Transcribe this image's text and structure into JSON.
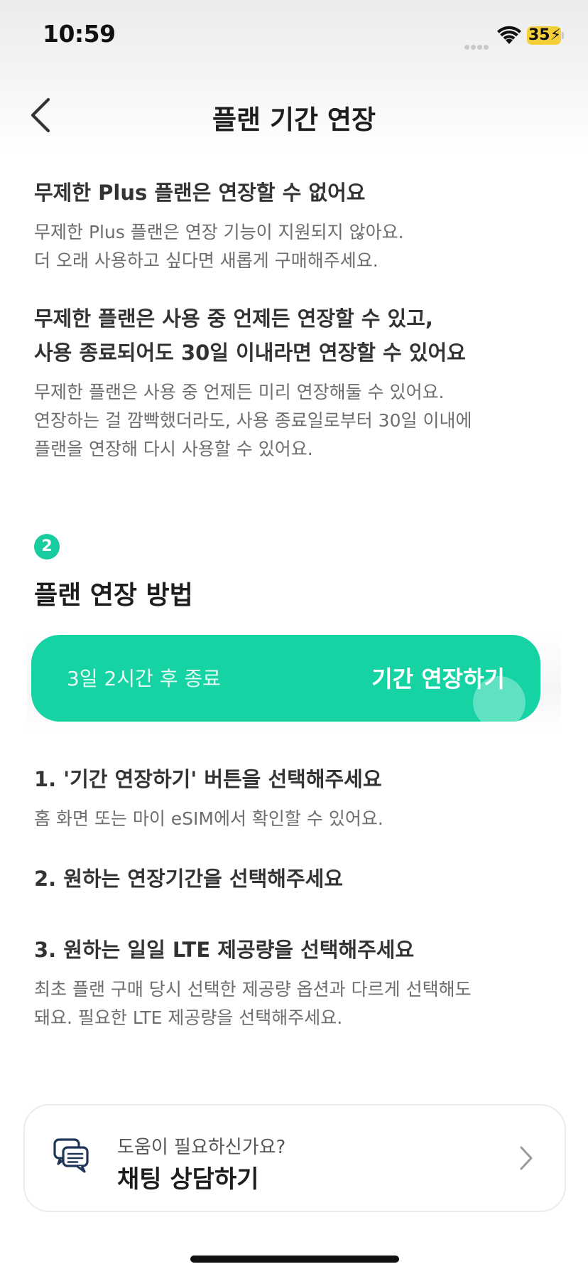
{
  "status_bar": {
    "time": "10:59",
    "battery": "35",
    "icons": [
      "cellular-signal-icon",
      "wifi-icon",
      "battery-charging-icon"
    ]
  },
  "header": {
    "title": "플랜 기간 연장",
    "back_icon": "chevron-left-icon"
  },
  "notes": [
    {
      "heading_lines": [
        "무제한 Plus 플랜은 연장할 수 없어요"
      ],
      "body_lines": [
        "무제한 Plus 플랜은 연장 기능이 지원되지 않아요.",
        "더 오래 사용하고 싶다면 새롭게 구매해주세요."
      ]
    },
    {
      "heading_lines": [
        "무제한 플랜은 사용 중 언제든 연장할 수 있고,",
        "사용 종료되어도 30일 이내라면 연장할 수 있어요"
      ],
      "body_lines": [
        "무제한 플랜은 사용 중 언제든 미리 연장해둘 수 있어요.",
        "연장하는 걸 깜빡했더라도, 사용 종료일로부터 30일 이내에",
        "플랜을 연장해 다시 사용할 수 있어요."
      ]
    }
  ],
  "section": {
    "step_number": "2",
    "title": "플랜 연장 방법"
  },
  "cta": {
    "remaining": "3일 2시간 후 종료",
    "action": "기간 연장하기"
  },
  "steps": [
    {
      "title": "1. '기간 연장하기' 버튼을 선택해주세요",
      "desc_lines": [
        "홈 화면 또는 마이 eSIM에서 확인할 수 있어요."
      ]
    },
    {
      "title": "2. 원하는 연장기간을 선택해주세요",
      "desc_lines": []
    },
    {
      "title": "3. 원하는 일일 LTE 제공량을 선택해주세요",
      "desc_lines": [
        "최초 플랜 구매 당시 선택한 제공량 옵션과 다르게 선택해도",
        "돼요. 필요한 LTE 제공량을 선택해주세요."
      ]
    }
  ],
  "help": {
    "subtitle": "도움이 필요하신가요?",
    "action": "채팅 상담하기",
    "icon": "chat-bubbles-icon"
  },
  "colors": {
    "accent": "#16d3a4",
    "badge": "#17cc9e",
    "battery": "#f5cf3a"
  }
}
